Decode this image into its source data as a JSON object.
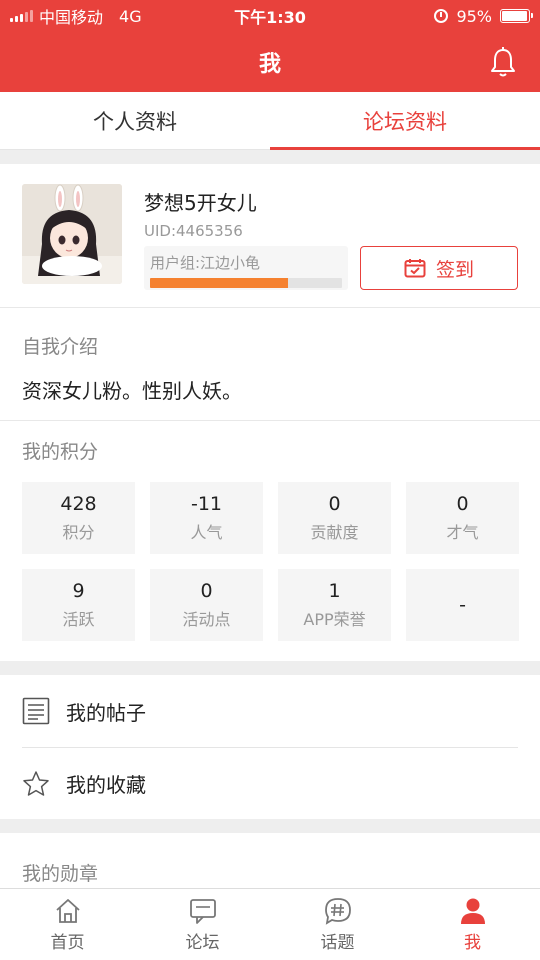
{
  "status": {
    "carrier": "中国移动",
    "network": "4G",
    "time": "下午1:30",
    "battery": "95%",
    "battery_level": 0.95
  },
  "header": {
    "title": "我"
  },
  "tabs": [
    {
      "label": "个人资料",
      "active": false
    },
    {
      "label": "论坛资料",
      "active": true
    }
  ],
  "profile": {
    "name": "梦想5开女儿",
    "uid": "UID:4465356",
    "group": "用户组:江边小龟",
    "group_progress": 0.72,
    "signin_label": "签到"
  },
  "intro": {
    "title": "自我介绍",
    "text": "资深女儿粉。性别人妖。"
  },
  "points": {
    "title": "我的积分",
    "items": [
      {
        "value": "428",
        "label": "积分"
      },
      {
        "value": "-11",
        "label": "人气"
      },
      {
        "value": "0",
        "label": "贡献度"
      },
      {
        "value": "0",
        "label": "才气"
      },
      {
        "value": "9",
        "label": "活跃"
      },
      {
        "value": "0",
        "label": "活动点"
      },
      {
        "value": "1",
        "label": "APP荣誉"
      },
      {
        "value": "-",
        "label": ""
      }
    ]
  },
  "menu": [
    {
      "label": "我的帖子",
      "icon": "document-icon"
    },
    {
      "label": "我的收藏",
      "icon": "star-icon"
    }
  ],
  "medals": {
    "title": "我的勋章"
  },
  "bottom_nav": [
    {
      "label": "首页",
      "icon": "home-icon",
      "active": false
    },
    {
      "label": "论坛",
      "icon": "chat-icon",
      "active": false
    },
    {
      "label": "话题",
      "icon": "hashtag-icon",
      "active": false
    },
    {
      "label": "我",
      "icon": "user-icon",
      "active": true
    }
  ],
  "colors": {
    "accent": "#e8413c",
    "progress": "#f5812f"
  }
}
